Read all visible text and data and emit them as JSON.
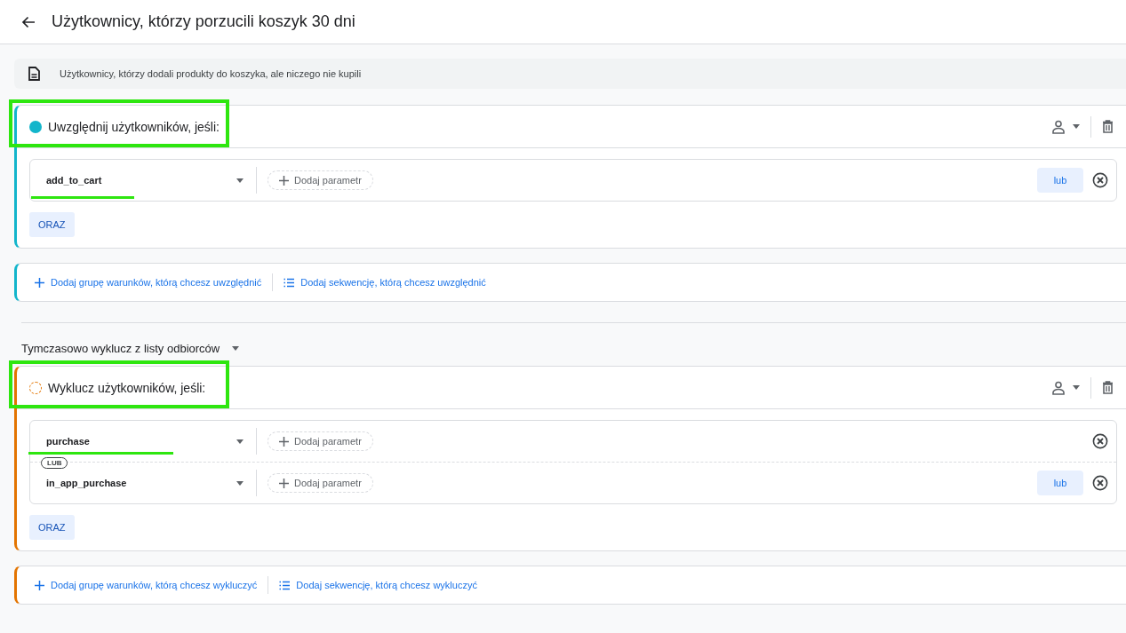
{
  "header": {
    "title": "Użytkownicy, którzy porzucili koszyk 30 dni"
  },
  "description": "Użytkownicy, którzy dodali produkty do koszyka, ale niczego nie kupili",
  "groups": [
    {
      "kind": "include",
      "title": "Uwzględnij użytkowników, jeśli:",
      "title_highlighted": true,
      "conditions": [
        {
          "event": "add_to_cart",
          "add_param": "Dodaj parametr",
          "or_button": "lub",
          "highlighted": true
        }
      ],
      "and_button": "ORAZ",
      "add_group": "Dodaj grupę warunków, którą chcesz uwzględnić",
      "add_sequence": "Dodaj sekwencję, którą chcesz uwzględnić"
    },
    {
      "kind": "exclude",
      "prefix_label": "Tymczasowo wyklucz z listy odbiorców",
      "title": "Wyklucz użytkowników, jeśli:",
      "title_highlighted": true,
      "conditions": [
        {
          "event": "purchase",
          "add_param": "Dodaj parametr",
          "highlighted": true
        },
        {
          "connector": "LUB",
          "event": "in_app_purchase",
          "add_param": "Dodaj parametr",
          "or_button": "lub"
        }
      ],
      "and_button": "ORAZ",
      "add_group": "Dodaj grupę warunków, którą chcesz wykluczyć",
      "add_sequence": "Dodaj sekwencję, którą chcesz wykluczyć"
    }
  ]
}
